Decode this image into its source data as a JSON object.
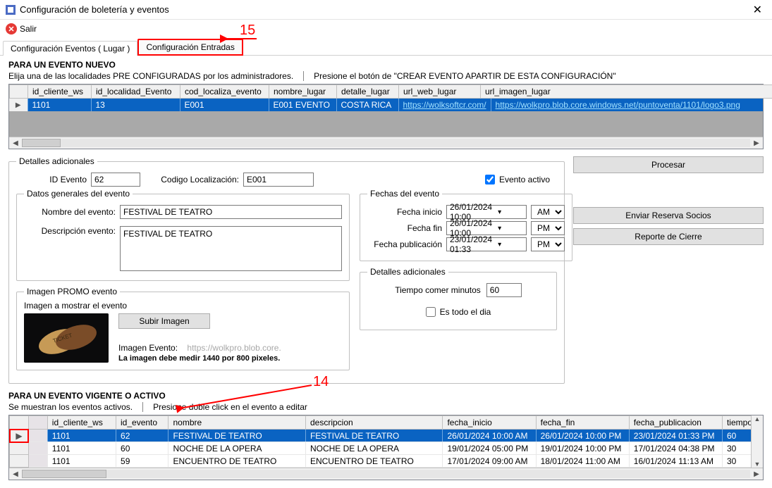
{
  "window": {
    "title": "Configuración de boletería y eventos"
  },
  "toolbar": {
    "exit": "Salir"
  },
  "tabs": {
    "tab1": "Configuración Eventos ( Lugar )",
    "tab2": "Configuración Entradas"
  },
  "annotations": {
    "n15": "15",
    "n14": "14"
  },
  "section_new": {
    "heading": "PARA UN EVENTO NUEVO",
    "hint1": "Elija una de las localidades PRE CONFIGURADAS por los administradores.",
    "hint2": "Presione el botón de \"CREAR EVENTO APARTIR DE ESTA CONFIGURACIÓN\""
  },
  "grid1": {
    "columns": [
      "id_cliente_ws",
      "id_localidad_Evento",
      "cod_localiza_evento",
      "nombre_lugar",
      "detalle_lugar",
      "url_web_lugar",
      "url_imagen_lugar"
    ],
    "row": {
      "id_cliente_ws": "1101",
      "id_localidad_Evento": "13",
      "cod_localiza_evento": "E001",
      "nombre_lugar": "E001 EVENTO",
      "detalle_lugar": "COSTA RICA",
      "url_web_lugar": "https://wolksoftcr.com/",
      "url_imagen_lugar": "https://wolkpro.blob.core.windows.net/puntoventa/1101/logo3.png"
    }
  },
  "details": {
    "legend": "Detalles adicionales",
    "id_evento_label": "ID Evento",
    "id_evento": "62",
    "cod_loc_label": "Codigo Localización:",
    "cod_loc": "E001",
    "active_label": "Evento activo",
    "generales_legend": "Datos generales del evento",
    "nombre_label": "Nombre del evento:",
    "nombre": "FESTIVAL DE TEATRO",
    "desc_label": "Descripción evento:",
    "desc": "FESTIVAL DE TEATRO",
    "fechas_legend": "Fechas del evento",
    "fini_label": "Fecha inicio",
    "fini": "26/01/2024 10:00",
    "fini_ampm": "AM",
    "ffin_label": "Fecha fin",
    "ffin": "26/01/2024 10:00",
    "ffin_ampm": "PM",
    "fpub_label": "Fecha publicación",
    "fpub": "23/01/2024 01:33",
    "fpub_ampm": "PM",
    "promo_legend": "Imagen PROMO evento",
    "promo_sub": "Imagen a mostrar el evento",
    "promo_btn": "Subir Imagen",
    "promo_lbl": "Imagen Evento:",
    "promo_url": "https://wolkpro.blob.core.",
    "promo_dim": "La imagen debe medir 1440 por 800 pixeles.",
    "extra_legend": "Detalles adicionales",
    "tiempo_label": "Tiempo comer minutos",
    "tiempo": "60",
    "allday_label": "Es todo el dia"
  },
  "buttons": {
    "procesar": "Procesar",
    "enviar": "Enviar Reserva Socios",
    "reporte": "Reporte de Cierre"
  },
  "section_active": {
    "heading": "PARA UN EVENTO VIGENTE O ACTIVO",
    "hint1": "Se muestran los eventos activos.",
    "hint2": "Presione doble click en el evento a editar"
  },
  "grid2": {
    "columns": [
      "id_cliente_ws",
      "id_evento",
      "nombre",
      "descripcion",
      "fecha_inicio",
      "fecha_fin",
      "fecha_publicacion",
      "tiempo_come"
    ],
    "rows": [
      {
        "id_cliente_ws": "1101",
        "id_evento": "62",
        "nombre": "FESTIVAL DE TEATRO",
        "descripcion": "FESTIVAL DE TEATRO",
        "fecha_inicio": "26/01/2024 10:00 AM",
        "fecha_fin": "26/01/2024 10:00 PM",
        "fecha_publicacion": "23/01/2024 01:33 PM",
        "tiempo_come": "60"
      },
      {
        "id_cliente_ws": "1101",
        "id_evento": "60",
        "nombre": "NOCHE DE LA OPERA",
        "descripcion": "NOCHE DE LA OPERA",
        "fecha_inicio": "19/01/2024 05:00 PM",
        "fecha_fin": "19/01/2024 10:00 PM",
        "fecha_publicacion": "17/01/2024 04:38 PM",
        "tiempo_come": "30"
      },
      {
        "id_cliente_ws": "1101",
        "id_evento": "59",
        "nombre": "ENCUENTRO DE TEATRO",
        "descripcion": "ENCUENTRO DE TEATRO",
        "fecha_inicio": "17/01/2024 09:00 AM",
        "fecha_fin": "18/01/2024 11:00 AM",
        "fecha_publicacion": "16/01/2024 11:13 AM",
        "tiempo_come": "30"
      }
    ]
  }
}
